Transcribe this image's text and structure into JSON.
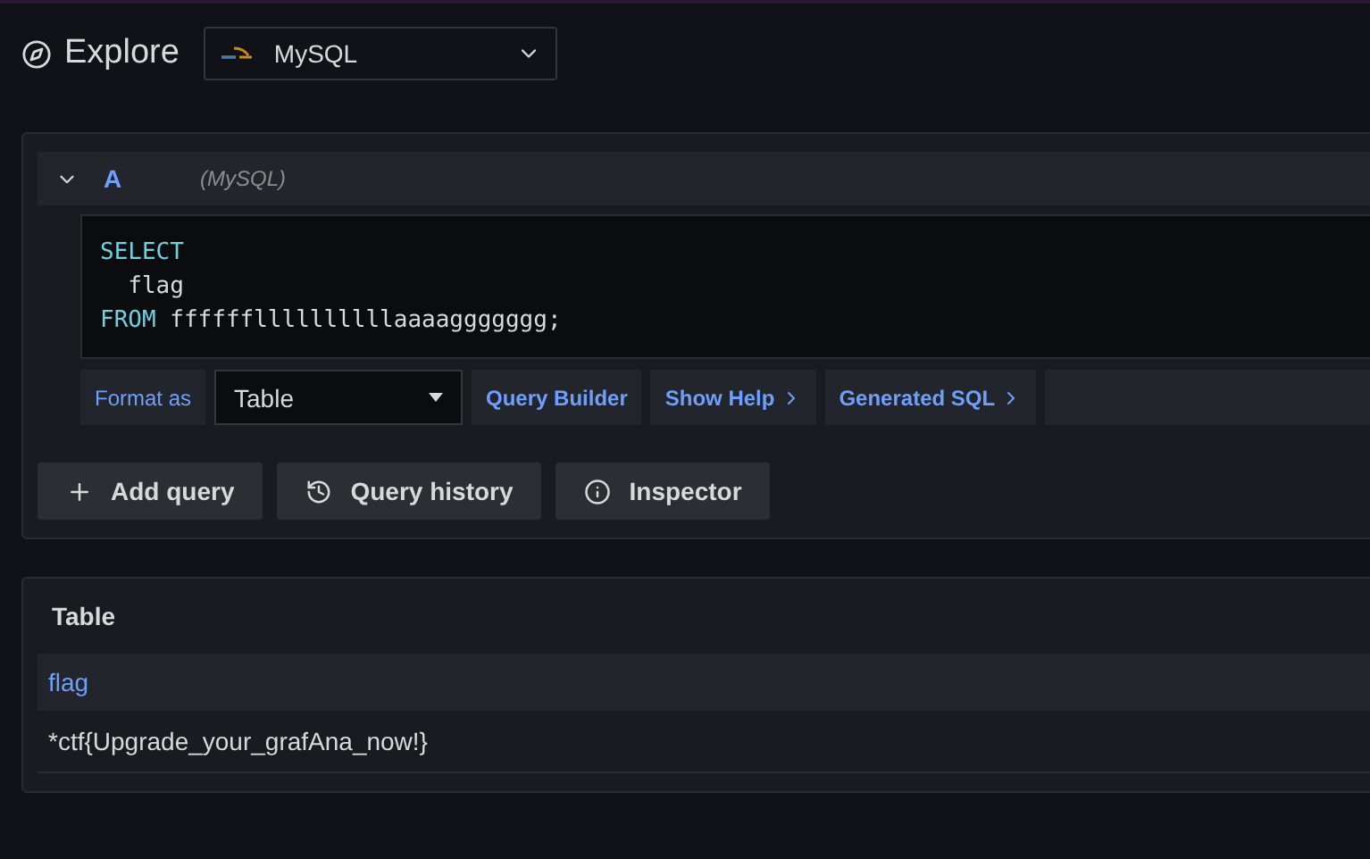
{
  "header": {
    "title": "Explore",
    "datasource": "MySQL"
  },
  "query": {
    "refId": "A",
    "expanded": true,
    "datasource": "(MySQL)",
    "code": [
      [
        {
          "kind": "keyword",
          "text": "SELECT"
        }
      ],
      [
        {
          "kind": "text",
          "text": "  flag"
        }
      ],
      [
        {
          "kind": "keyword",
          "text": "FROM"
        },
        {
          "kind": "text",
          "text": " ffffffllllllllllaaaaggggggg;"
        }
      ]
    ],
    "format_label": "Format as",
    "format_value": "Table",
    "links": [
      {
        "label": "Query Builder",
        "chevron": false
      },
      {
        "label": "Show Help",
        "chevron": true
      },
      {
        "label": "Generated SQL",
        "chevron": true
      }
    ]
  },
  "actions": [
    {
      "kind": "add",
      "label": "Add query"
    },
    {
      "kind": "history",
      "label": "Query history"
    },
    {
      "kind": "info",
      "label": "Inspector"
    }
  ],
  "table": {
    "title": "Table",
    "columns": [
      "flag"
    ],
    "rows": [
      [
        "*ctf{Upgrade_your_grafAna_now!}"
      ]
    ]
  }
}
